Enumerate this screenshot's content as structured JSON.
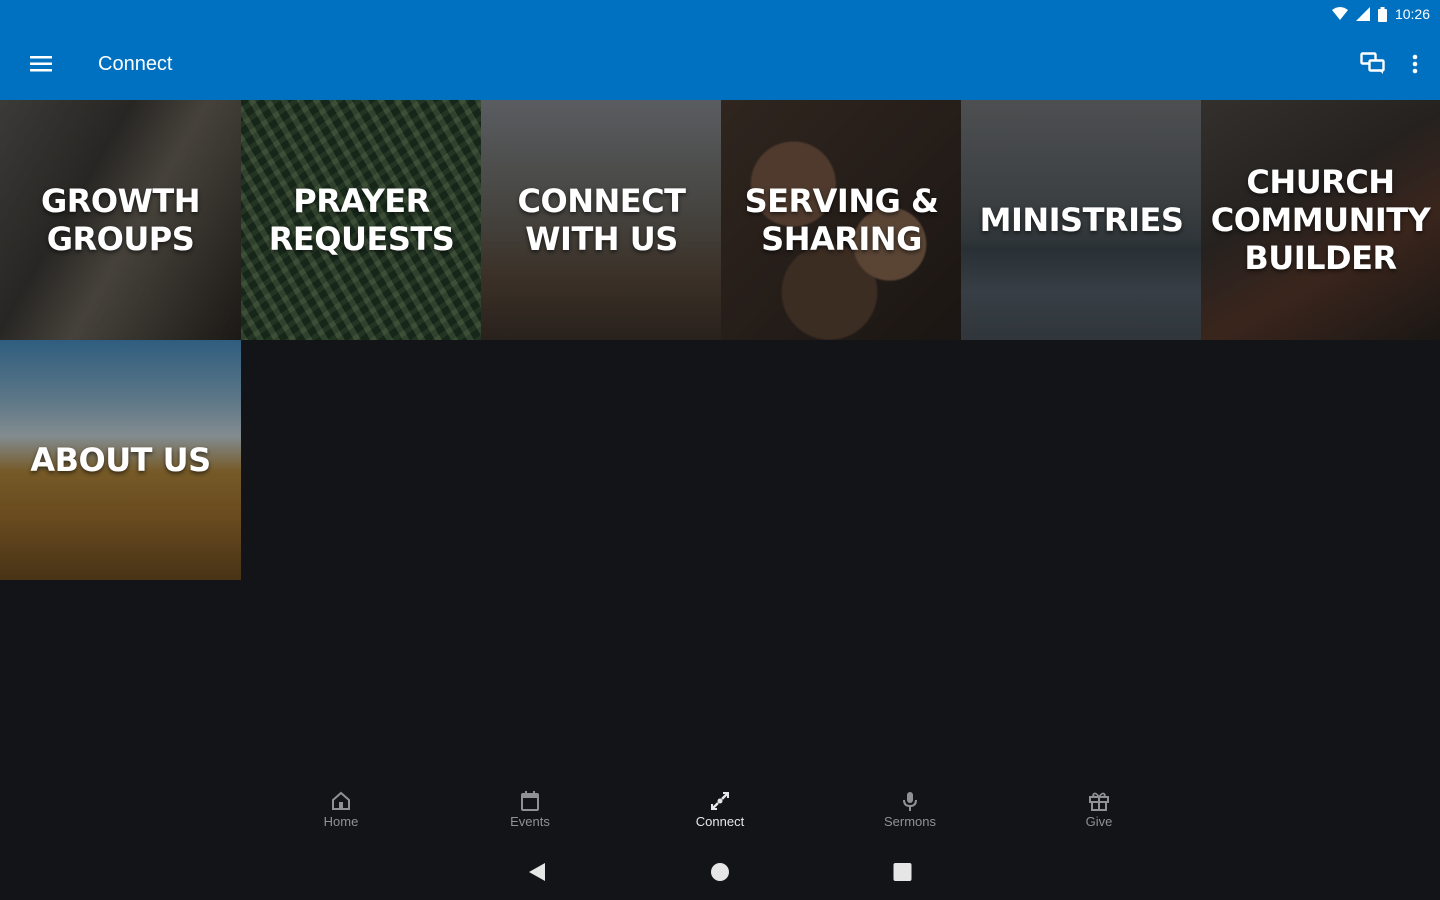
{
  "status_bar": {
    "time": "10:26",
    "icons": [
      "wifi-icon",
      "signal-icon",
      "battery-icon"
    ]
  },
  "app_bar": {
    "title": "Connect",
    "menu_icon": "hamburger-menu-icon",
    "actions": [
      "chat-icon",
      "more-vert-icon"
    ],
    "color": "#0070c0"
  },
  "tiles": [
    {
      "label": "Growth Groups"
    },
    {
      "label": "Prayer Requests"
    },
    {
      "label": "Connect With Us"
    },
    {
      "label": "Serving & Sharing"
    },
    {
      "label": "Ministries"
    },
    {
      "label": "Church Community Builder"
    },
    {
      "label": "About Us"
    }
  ],
  "bottom_nav": {
    "items": [
      {
        "label": "Home",
        "icon": "home-icon",
        "active": false
      },
      {
        "label": "Events",
        "icon": "calendar-icon",
        "active": false
      },
      {
        "label": "Connect",
        "icon": "connect-icon",
        "active": true
      },
      {
        "label": "Sermons",
        "icon": "microphone-icon",
        "active": false
      },
      {
        "label": "Give",
        "icon": "gift-icon",
        "active": false
      }
    ]
  },
  "system_nav": [
    "back-icon",
    "home-circle-icon",
    "recents-icon"
  ],
  "colors": {
    "background": "#131417",
    "accent": "#0070c0"
  }
}
